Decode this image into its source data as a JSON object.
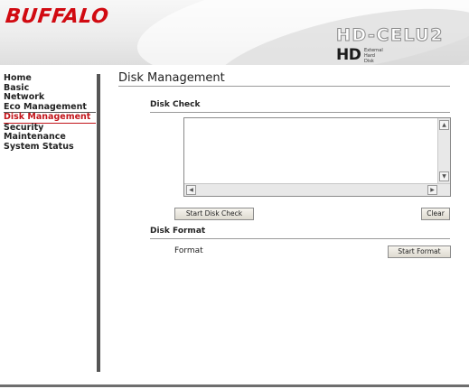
{
  "brand": {
    "logo": "BUFFALO",
    "model": "HD-CELU2",
    "hd_mark": "HD",
    "hd_sub": "External Hard Disk"
  },
  "nav": {
    "items": [
      {
        "label": "Home"
      },
      {
        "label": "Basic"
      },
      {
        "label": "Network"
      },
      {
        "label": "Eco Management"
      },
      {
        "label": "Disk Management"
      },
      {
        "label": "Security"
      },
      {
        "label": "Maintenance"
      },
      {
        "label": "System Status"
      }
    ],
    "active": "Disk Management"
  },
  "page": {
    "title": "Disk Management"
  },
  "disk_check": {
    "title": "Disk Check",
    "log_text": "",
    "start_button": "Start Disk Check",
    "clear_button": "Clear"
  },
  "disk_format": {
    "title": "Disk Format",
    "format_label": "Format",
    "start_button": "Start Format"
  },
  "colors": {
    "brand_red": "#d10a11",
    "active_nav": "#c2141a",
    "nav_bar": "#555555"
  }
}
